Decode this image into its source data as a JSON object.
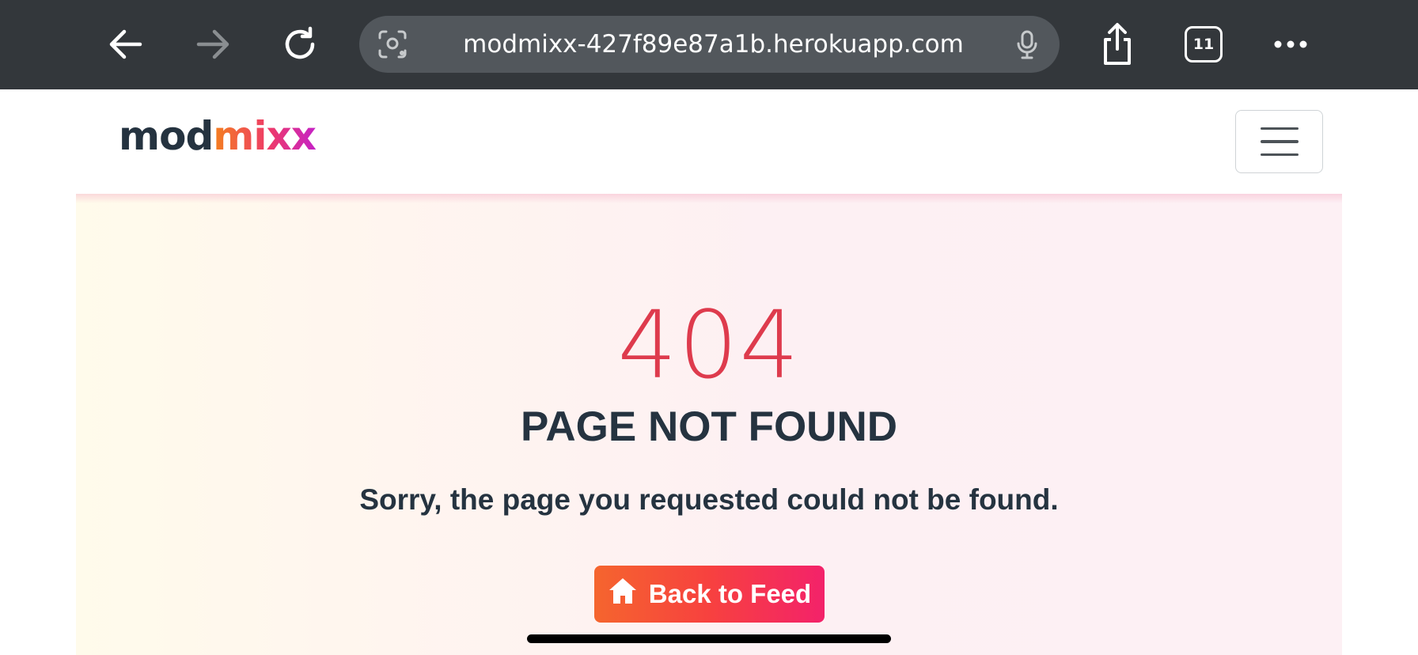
{
  "browser": {
    "url": "modmixx-427f89e87a1b.herokuapp.com",
    "tab_count": "11",
    "icons": [
      "back-arrow-icon",
      "forward-arrow-icon",
      "reload-icon",
      "screen-search-icon",
      "microphone-icon",
      "share-icon",
      "tabs-icon",
      "more-icon"
    ]
  },
  "navbar": {
    "logo_part1": "mod",
    "logo_part2": "mixx",
    "menu_icon": "hamburger-icon"
  },
  "error": {
    "code": "404",
    "title": "PAGE NOT FOUND",
    "message": "Sorry, the page you requested could not be found.",
    "button_label": "Back to Feed",
    "button_icon": "home-icon"
  },
  "colors": {
    "toolbar_bg": "#33373b",
    "error_code": "#de3b4d",
    "text_dark": "#253340",
    "button_gradient_start": "#f5652e",
    "button_gradient_end": "#f3226a"
  }
}
